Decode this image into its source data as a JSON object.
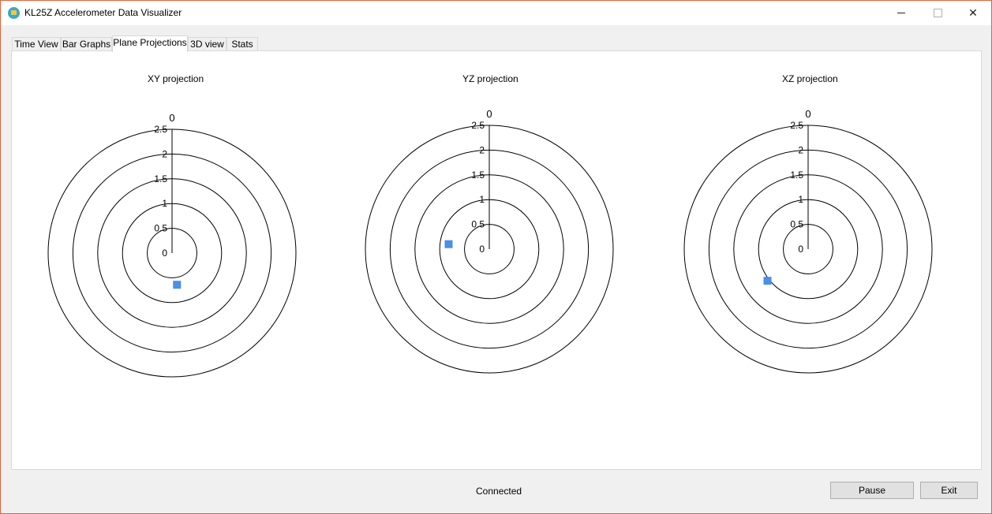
{
  "window": {
    "title": "KL25Z Accelerometer Data Visualizer",
    "controls": {
      "minimize": "—",
      "maximize": "☐",
      "close": "✕"
    }
  },
  "tabs": [
    {
      "label": "Time View",
      "active": false
    },
    {
      "label": "Bar Graphs",
      "active": false
    },
    {
      "label": "Plane Projections",
      "active": true
    },
    {
      "label": "3D view",
      "active": false
    },
    {
      "label": "Stats",
      "active": false
    }
  ],
  "projections": [
    {
      "title": "XY projection",
      "top_label": "0",
      "ticks": [
        "0",
        "0.5",
        "1",
        "1.5",
        "2",
        "2.5"
      ]
    },
    {
      "title": "YZ projection",
      "top_label": "0",
      "ticks": [
        "0",
        "0.5",
        "1",
        "1.5",
        "2",
        "2.5"
      ]
    },
    {
      "title": "XZ projection",
      "top_label": "0",
      "ticks": [
        "0",
        "0.5",
        "1",
        "1.5",
        "2",
        "2.5"
      ]
    }
  ],
  "chart_data": [
    {
      "type": "scatter",
      "title": "XY projection",
      "r_max": 2.5,
      "ticks": [
        0,
        0.5,
        1,
        1.5,
        2,
        2.5
      ],
      "points": [
        {
          "x": 0.1,
          "y": -0.64
        }
      ],
      "marker_color": "#4a8fe8"
    },
    {
      "type": "scatter",
      "title": "YZ projection",
      "r_max": 2.5,
      "ticks": [
        0,
        0.5,
        1,
        1.5,
        2,
        2.5
      ],
      "points": [
        {
          "x": -0.82,
          "y": 0.1
        }
      ],
      "marker_color": "#4a8fe8"
    },
    {
      "type": "scatter",
      "title": "XZ projection",
      "r_max": 2.5,
      "ticks": [
        0,
        0.5,
        1,
        1.5,
        2,
        2.5
      ],
      "points": [
        {
          "x": -0.82,
          "y": -0.64
        }
      ],
      "marker_color": "#4a8fe8"
    }
  ],
  "status": {
    "text": "Connected"
  },
  "buttons": {
    "pause": "Pause",
    "exit": "Exit"
  }
}
